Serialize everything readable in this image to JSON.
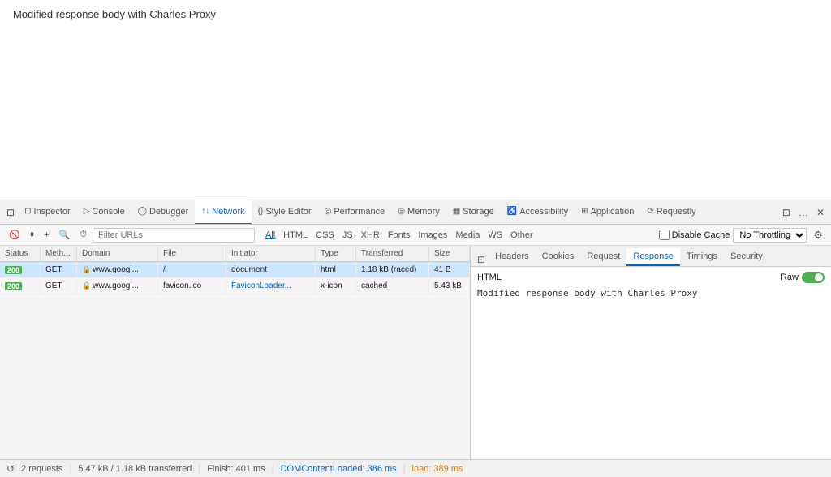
{
  "page": {
    "title": "Modified response body with Charles Proxy"
  },
  "devtools": {
    "tabs": [
      {
        "id": "inspector",
        "label": "Inspector",
        "icon": "⊡",
        "active": false
      },
      {
        "id": "console",
        "label": "Console",
        "icon": "▷",
        "active": false
      },
      {
        "id": "debugger",
        "label": "Debugger",
        "icon": "◯",
        "active": false
      },
      {
        "id": "network",
        "label": "Network",
        "icon": "↑↓",
        "active": true
      },
      {
        "id": "style-editor",
        "label": "Style Editor",
        "icon": "{}",
        "active": false
      },
      {
        "id": "performance",
        "label": "Performance",
        "icon": "◎",
        "active": false
      },
      {
        "id": "memory",
        "label": "Memory",
        "icon": "◎",
        "active": false
      },
      {
        "id": "storage",
        "label": "Storage",
        "icon": "▦",
        "active": false
      },
      {
        "id": "accessibility",
        "label": "Accessibility",
        "icon": "♿",
        "active": false
      },
      {
        "id": "application",
        "label": "Application",
        "icon": "⊞",
        "active": false
      },
      {
        "id": "requestly",
        "label": "Requestly",
        "icon": "⟳",
        "active": false
      }
    ],
    "toolbar_buttons": {
      "dock": "⊡",
      "more": "…",
      "close": "✕"
    }
  },
  "network": {
    "filter_placeholder": "Filter URLs",
    "type_filters": [
      "All",
      "HTML",
      "CSS",
      "JS",
      "XHR",
      "Fonts",
      "Images",
      "Media",
      "WS",
      "Other"
    ],
    "active_type_filter": "All",
    "disable_cache_label": "Disable Cache",
    "throttle_label": "No Throttling ▾",
    "columns": [
      "Status",
      "Meth...",
      "Domain",
      "File",
      "Initiator",
      "Type",
      "Transferred",
      "Size"
    ],
    "rows": [
      {
        "status": "200",
        "method": "GET",
        "domain": "www.googl...",
        "file": "/",
        "initiator": "document",
        "type": "html",
        "transferred": "1.18 kB (raced)",
        "size": "41 B",
        "selected": true,
        "has_lock": true
      },
      {
        "status": "200",
        "method": "GET",
        "domain": "www.googl...",
        "file": "favicon.ico",
        "initiator": "FaviconLoader...",
        "type": "x-icon",
        "transferred": "cached",
        "size": "5.43 kB",
        "selected": false,
        "has_lock": true
      }
    ]
  },
  "response_panel": {
    "tabs": [
      "Headers",
      "Cookies",
      "Request",
      "Response",
      "Timings",
      "Security"
    ],
    "active_tab": "Response",
    "subheader_type": "HTML",
    "raw_label": "Raw",
    "response_text": "Modified response body with Charles Proxy"
  },
  "status_bar": {
    "requests": "2 requests",
    "transferred": "5.47 kB / 1.18 kB transferred",
    "finish": "Finish: 401 ms",
    "dom_content_loaded": "DOMContentLoaded: 386 ms",
    "load": "load: 389 ms"
  }
}
